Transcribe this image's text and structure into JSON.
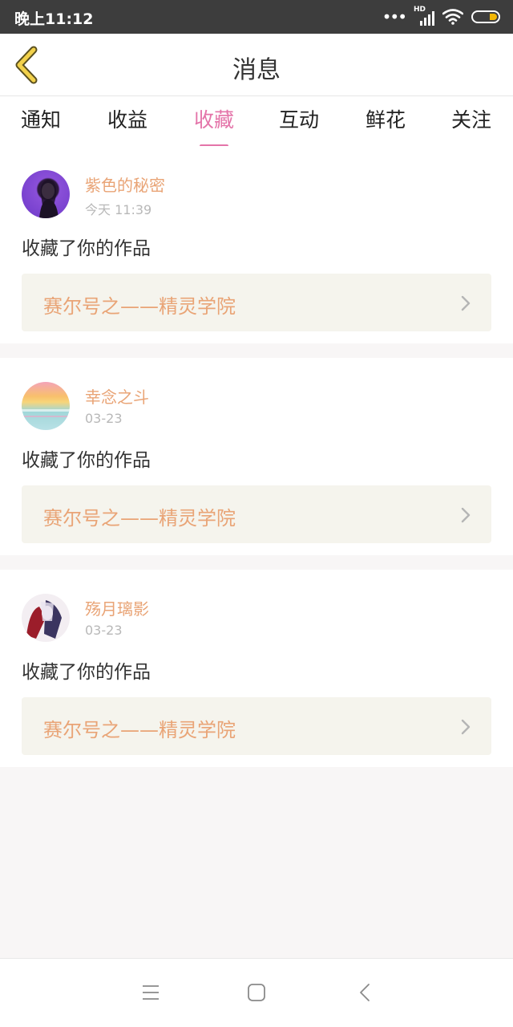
{
  "status_bar": {
    "time": "晚上11:12",
    "network_label": "HD",
    "battery_color": "#f2b705"
  },
  "header": {
    "back_icon": "chevron-left-icon",
    "title": "消息"
  },
  "tabs": [
    {
      "label": "通知",
      "active": false
    },
    {
      "label": "收益",
      "active": false
    },
    {
      "label": "收藏",
      "active": true
    },
    {
      "label": "互动",
      "active": false
    },
    {
      "label": "鲜花",
      "active": false
    },
    {
      "label": "关注",
      "active": false
    }
  ],
  "messages": [
    {
      "username": "紫色的秘密",
      "time": "今天 11:39",
      "action": "收藏了你的作品",
      "work_title": "赛尔号之——精灵学院"
    },
    {
      "username": "幸念之斗",
      "time": "03-23",
      "action": "收藏了你的作品",
      "work_title": "赛尔号之——精灵学院"
    },
    {
      "username": "殇月璃影",
      "time": "03-23",
      "action": "收藏了你的作品",
      "work_title": "赛尔号之——精灵学院"
    }
  ],
  "nav_bar": {
    "menu_icon": "menu-icon",
    "home_icon": "home-square-icon",
    "back_icon": "back-triangle-icon"
  },
  "colors": {
    "accent_pink": "#e474a9",
    "name_orange": "#e9a476",
    "card_bg": "#f5f4ed",
    "page_bg": "#f8f6f6"
  }
}
